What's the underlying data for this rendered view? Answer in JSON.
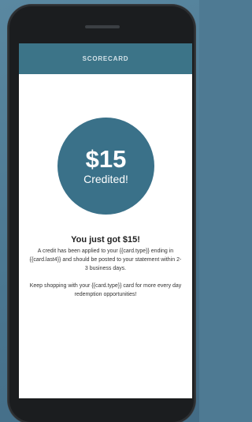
{
  "header": {
    "logo": "SCORECARD"
  },
  "credit": {
    "amount": "$15",
    "label": "Credited!"
  },
  "message": {
    "title": "You just got $15!",
    "body": "A credit has been applied to your {{card.type}} ending in {{card.last4}} and should be posted to your statement within 2-3 business days.",
    "tip": "Keep shopping with your {{card.type}} card for more every day redemption opportunities!"
  },
  "colors": {
    "brand": "#3a7189",
    "background": "#4e7a93",
    "text": "#333333"
  }
}
